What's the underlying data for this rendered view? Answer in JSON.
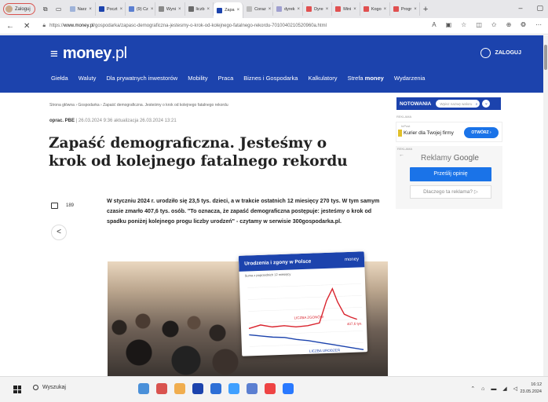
{
  "browser": {
    "profile_label": "Zaloguj",
    "tabs": [
      {
        "label": "Narz",
        "color": "#9fb3d9"
      },
      {
        "label": "Poczt",
        "color": "#1c43ad"
      },
      {
        "label": "(9) Cz",
        "color": "#5b7fd1"
      },
      {
        "label": "Wyni",
        "color": "#888888"
      },
      {
        "label": "liczb",
        "color": "#6a6a6a"
      },
      {
        "label": "Zapa",
        "color": "#1c43ad",
        "active": true
      },
      {
        "label": "Coraz",
        "color": "#bbbbbb"
      },
      {
        "label": "dyrek",
        "color": "#9f9fd0"
      },
      {
        "label": "Dyre",
        "color": "#e05050"
      },
      {
        "label": "Mini",
        "color": "#e05050"
      },
      {
        "label": "Kogo",
        "color": "#e05050"
      },
      {
        "label": "Progr",
        "color": "#e05050"
      }
    ],
    "url_prefix": "https://",
    "url_domain": "www.money.pl",
    "url_path": "/gospodarka/zapasc-demograficzna-jestesmy-o-krok-od-kolejnego-fatalnego-rekordu-7010040210520960a.html"
  },
  "site": {
    "logo_main": "money",
    "logo_suffix": ".pl",
    "login_label": "ZALOGUJ",
    "menu": [
      "Giełda",
      "Waluty",
      "Dla prywatnych inwestorów",
      "Mobility",
      "Praca",
      "Biznes i Gospodarka",
      "Kalkulatory"
    ],
    "menu_strefa_prefix": "Strefa",
    "menu_strefa_brand": "money",
    "menu_last": "Wydarzenia"
  },
  "article": {
    "breadcrumb": "Strona główna  ›  Gospodarka  ›  Zapaść demograficzna. Jesteśmy o krok od kolejnego fatalnego rekordu",
    "author": "oprac. PBE",
    "meta": "|  26.03.2024 9:36  aktualizacja 26.03.2024 13:21",
    "title": "Zapaść demograficzna. Jesteśmy o krok od kolejnego fatalnego rekordu",
    "lead": "W styczniu 2024 r. urodziło się 23,5 tys. dzieci, a w trakcie ostatnich 12 miesięcy 270 tys. W tym samym czasie zmarło 407,6 tys. osób. \"To oznacza, że zapaść demograficzna postępuje: jesteśmy o krok od spadku poniżej kolejnego progu liczby urodzeń\" - czytamy w serwisie 300gospodarka.pl.",
    "comments_count": "189",
    "chart_title": "Urodzenia i zgony w Polsce",
    "chart_brand": "money",
    "chart_subtitle": "Suma z poprzednich 12 miesięcy",
    "chart_series_deaths": "LICZBA ZGONÓW",
    "chart_series_births": "LICZBA URODZEŃ",
    "chart_value": "407,6 tys."
  },
  "sidebar": {
    "notowania_label": "NOTOWANIA",
    "search_placeholder": "Wpisz nazwę waloru",
    "ad_label_1": "REKLAMA",
    "ad_small_label": "InPost",
    "ad_text": "Kurier dla Twojej firmy",
    "ad_button": "OTWÓRZ",
    "ad_label_2": "REKLAMA",
    "google_brand_prefix": "Reklamy",
    "google_brand": "Google",
    "feedback_button": "Prześlij opinię",
    "why_button": "Dlaczego ta reklama?"
  },
  "taskbar": {
    "search_label": "Wyszukaj",
    "time": "16:12",
    "date": "23.05.2024",
    "apps": [
      "#4a90d9",
      "#d9534f",
      "#f0ad4e",
      "#1c43ad",
      "#2d6fd6",
      "#3fa0ff",
      "#5b7fd1",
      "#e44",
      "#2979ff"
    ]
  }
}
